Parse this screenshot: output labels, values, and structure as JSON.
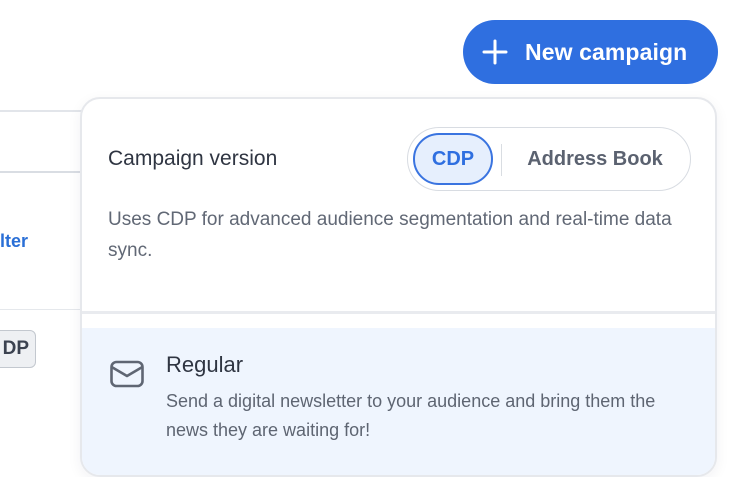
{
  "background": {
    "filter_link_fragment": "lter",
    "badge_fragment": "DP"
  },
  "toolbar": {
    "new_campaign_label": "New campaign",
    "new_campaign_icon": "plus-icon"
  },
  "dropdown": {
    "campaign_version": {
      "label": "Campaign version",
      "options": [
        "CDP",
        "Address Book"
      ],
      "selected": "CDP",
      "description": "Uses CDP for advanced audience segmentation and real-time data sync."
    },
    "campaign_types": [
      {
        "icon": "envelope-icon",
        "title": "Regular",
        "description": "Send a digital newsletter to your audience and bring them the news they are waiting for!"
      }
    ]
  },
  "colors": {
    "accent": "#2f6fe0",
    "selected_option_bg": "#e6effd",
    "hover_row_bg": "#eff5fe",
    "text_primary": "#2f3542",
    "text_secondary": "#616875"
  }
}
